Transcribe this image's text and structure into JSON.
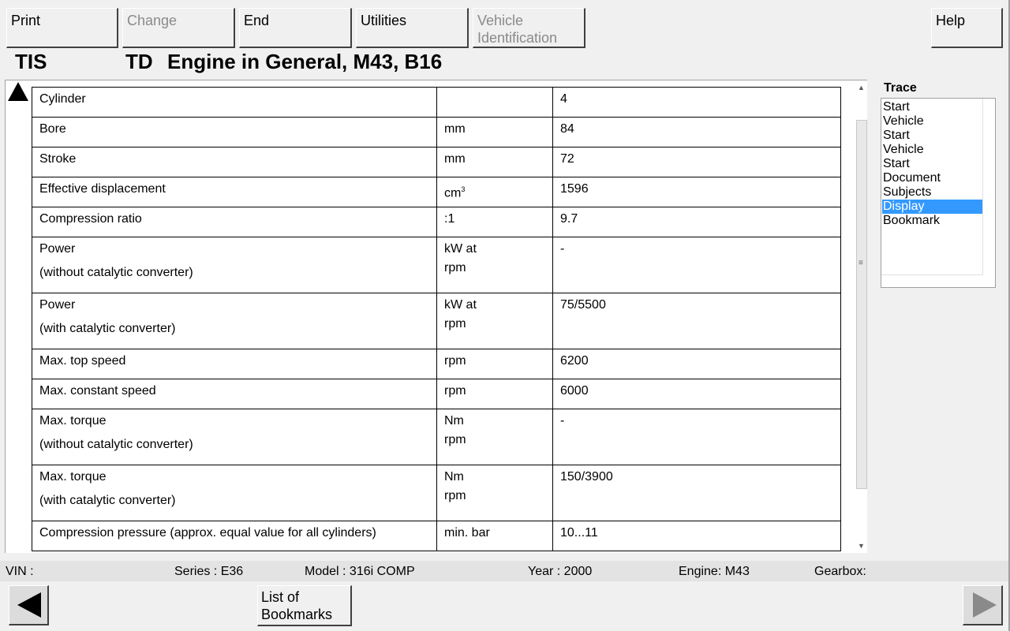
{
  "toolbar": {
    "print": "Print",
    "change": "Change",
    "end": "End",
    "utilities": "Utilities",
    "vehicle_id_line1": "Vehicle",
    "vehicle_id_line2": "Identification",
    "help": "Help"
  },
  "header": {
    "app": "TIS",
    "doc_type": "TD",
    "title": "Engine in General, M43, B16"
  },
  "table": {
    "rows": [
      {
        "param": "Cylinder",
        "unit": "",
        "value": "4"
      },
      {
        "param": "Bore",
        "unit": "mm",
        "value": "84"
      },
      {
        "param": "Stroke",
        "unit": "mm",
        "value": "72"
      },
      {
        "param": "Effective displacement",
        "unit": "cm",
        "unit_sup": "3",
        "value": "1596"
      },
      {
        "param": "Compression ratio",
        "unit": ":1",
        "value": "9.7"
      },
      {
        "param": "Power",
        "param2": "(without catalytic converter)",
        "unit": "kW at",
        "unit2": "rpm",
        "value": "-"
      },
      {
        "param": "Power",
        "param2": "(with catalytic converter)",
        "unit": "kW at",
        "unit2": "rpm",
        "value": "75/5500"
      },
      {
        "param": "Max. top speed",
        "unit": "rpm",
        "value": "6200"
      },
      {
        "param": "Max. constant speed",
        "unit": "rpm",
        "value": "6000"
      },
      {
        "param": "Max. torque",
        "param2": "(without catalytic converter)",
        "unit": "Nm",
        "unit2": "rpm",
        "value": "-"
      },
      {
        "param": "Max. torque",
        "param2": "(with catalytic converter)",
        "unit": "Nm",
        "unit2": "rpm",
        "value": "150/3900"
      },
      {
        "param": "Compression pressure (approx. equal value for all cylinders)",
        "unit": "min. bar",
        "value": "10...11"
      }
    ]
  },
  "trace": {
    "label": "Trace",
    "items": [
      "Start",
      "Vehicle",
      "Start",
      "Vehicle",
      "Start",
      "Document",
      "Subjects",
      "Display",
      "Bookmark"
    ],
    "selected_index": 7
  },
  "status": {
    "vin": "VIN :",
    "series": "Series : E36",
    "model": "Model : 316i COMP",
    "year": "Year : 2000",
    "engine": "Engine: M43",
    "gearbox": "Gearbox:"
  },
  "bottom": {
    "bookmarks_line1": "List of",
    "bookmarks_line2": "Bookmarks"
  },
  "icons": {
    "back": "left-triangle-icon",
    "forward": "right-triangle-icon",
    "scroll_up": "up-arrow-icon"
  }
}
